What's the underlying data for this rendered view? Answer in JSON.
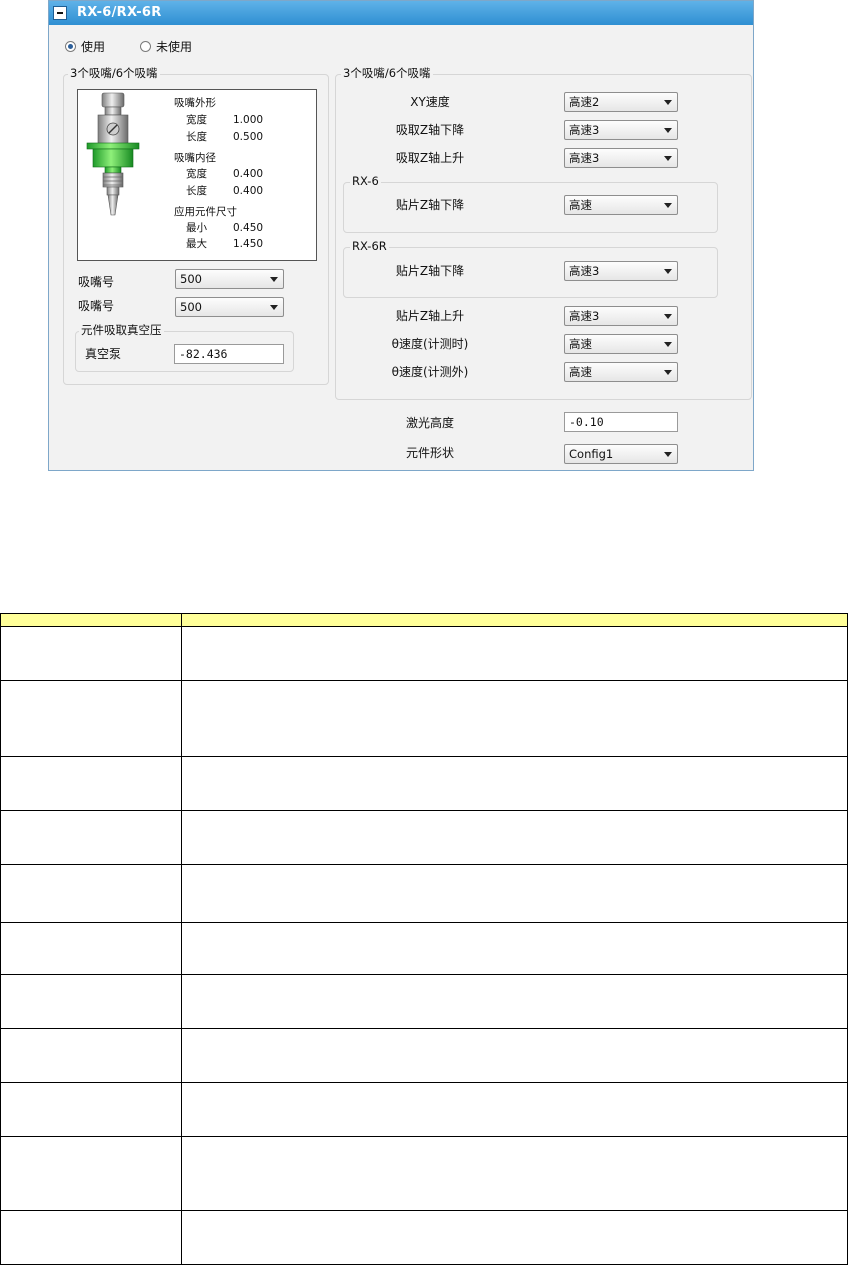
{
  "window": {
    "title": "RX-6/RX-6R"
  },
  "use_radio": {
    "use_label": "使用",
    "unuse_label": "未使用",
    "selected": "使用"
  },
  "left_group": {
    "label": "3个吸嘴/6个吸嘴",
    "nozzle_info": {
      "outer_heading": "吸嘴外形",
      "outer_width_label": "宽度",
      "outer_width": "1.000",
      "outer_length_label": "长度",
      "outer_length": "0.500",
      "inner_heading": "吸嘴内径",
      "inner_width_label": "宽度",
      "inner_width": "0.400",
      "inner_length_label": "长度",
      "inner_length": "0.400",
      "size_heading": "应用元件尺寸",
      "min_label": "最小",
      "min": "0.450",
      "max_label": "最大",
      "max": "1.450"
    },
    "nozzle1_label": "吸嘴号",
    "nozzle1_value": "500",
    "nozzle2_label": "吸嘴号",
    "nozzle2_value": "500",
    "vacuum_group_label": "元件吸取真空压",
    "vacuum_label": "真空泵",
    "vacuum_value": "-82.436"
  },
  "right_group": {
    "label": "3个吸嘴/6个吸嘴",
    "xy_speed_label": "XY速度",
    "xy_speed_value": "高速2",
    "pick_z_down_label": "吸取Z轴下降",
    "pick_z_down_value": "高速3",
    "pick_z_up_label": "吸取Z轴上升",
    "pick_z_up_value": "高速3",
    "rx6_label": "RX-6",
    "rx6_place_z_down_label": "贴片Z轴下降",
    "rx6_place_z_down_value": "高速",
    "rx6r_label": "RX-6R",
    "rx6r_place_z_down_label": "贴片Z轴下降",
    "rx6r_place_z_down_value": "高速3",
    "place_z_up_label": "贴片Z轴上升",
    "place_z_up_value": "高速3",
    "theta_measure_label": "θ速度(计测时)",
    "theta_measure_value": "高速",
    "theta_nonmeasure_label": "θ速度(计测外)",
    "theta_nonmeasure_value": "高速"
  },
  "laser_height_label": "激光高度",
  "laser_height_value": "-0.10",
  "part_shape_label": "元件形状",
  "part_shape_value": "Config1",
  "table": {
    "header_color": "#ffff99",
    "row_count": 11
  }
}
